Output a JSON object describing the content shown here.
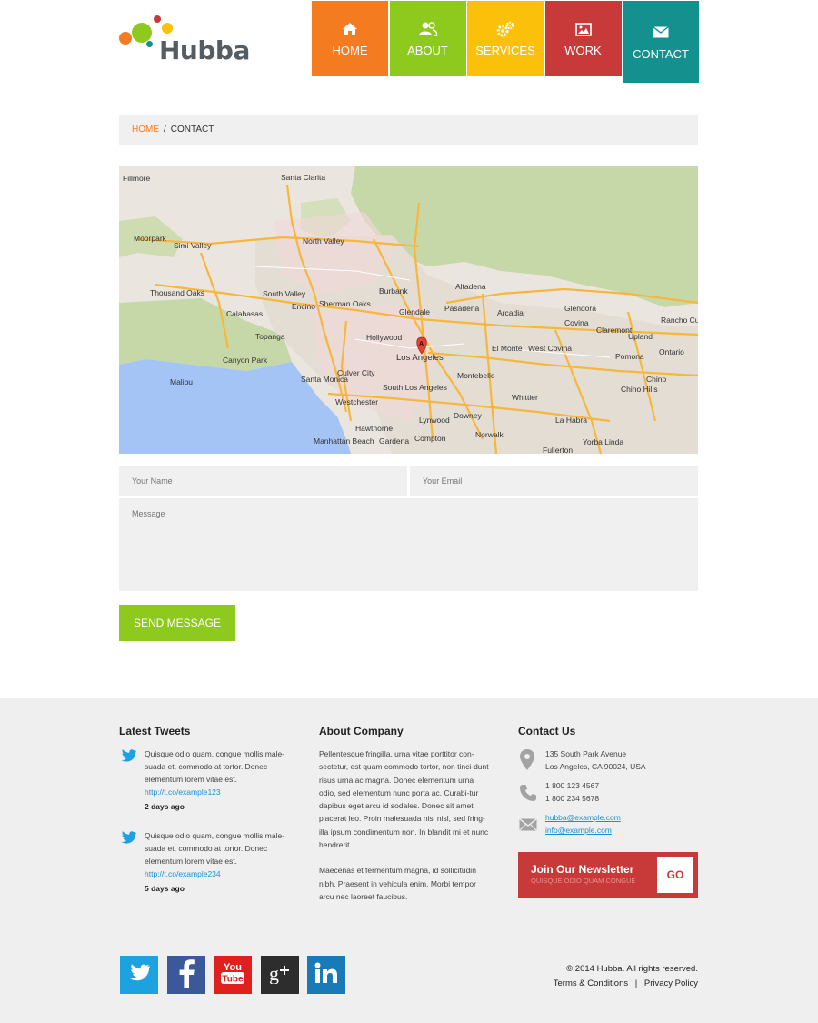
{
  "brand": {
    "name": "Hubba"
  },
  "nav": [
    {
      "label": "HOME",
      "color": "#f47b20",
      "icon": "home-icon"
    },
    {
      "label": "ABOUT",
      "color": "#8ec91e",
      "icon": "users-icon"
    },
    {
      "label": "SERVICES",
      "color": "#fbc10a",
      "icon": "gears-icon"
    },
    {
      "label": "WORK",
      "color": "#c73a39",
      "icon": "image-icon"
    },
    {
      "label": "CONTACT",
      "color": "#14908f",
      "icon": "envelope-icon",
      "active": true
    }
  ],
  "breadcrumb": {
    "home": "HOME",
    "separator": "/",
    "current": "CONTACT"
  },
  "map": {
    "labels": [
      "Santa Clarita",
      "Fillmore",
      "Moorpark",
      "Simi Valley",
      "North Valley",
      "Thousand Oaks",
      "South Valley",
      "Burbank",
      "Glendale",
      "Pasadena",
      "Arcadia",
      "Calabasas",
      "Hollywood",
      "Los Angeles",
      "El Monte",
      "West Covina",
      "Pomona",
      "Ontario",
      "Malibu",
      "Santa Monica",
      "Culver City",
      "South Los Angeles",
      "Montebello",
      "Downey",
      "Whittier",
      "Hawthorne",
      "Compton",
      "Norwalk",
      "La Habra",
      "Fullerton",
      "Yorba Linda",
      "Chino",
      "Chino Hills",
      "Westchester",
      "Manhattan Beach",
      "Gardena",
      "Lynwood",
      "Topanga",
      "Canyon Park",
      "Sherman Oaks",
      "Encino",
      "Altadena",
      "Covina",
      "Glendora",
      "Claremont",
      "Upland",
      "Rancho Cucamonga"
    ],
    "marker": "A"
  },
  "form": {
    "name_placeholder": "Your Name",
    "email_placeholder": "Your Email",
    "message_placeholder": "Message",
    "send_label": "SEND MESSAGE"
  },
  "footer": {
    "tweets_title": "Latest Tweets",
    "tweets": [
      {
        "text": "Quisque odio quam, congue mollis male-suada et, commodo at tortor. Donec elementum lorem vitae est.",
        "link": "http://t.co/example123",
        "ago": "2 days ago"
      },
      {
        "text": "Quisque odio quam, congue mollis male-suada et, commodo at tortor. Donec elementum lorem vitae est.",
        "link": "http://t.co/example234",
        "ago": "5 days ago"
      }
    ],
    "about_title": "About Company",
    "about_p1": "Pellentesque fringilla, urna vitae porttitor con-sectetur, est quam commodo tortor, non tinci-dunt risus urna ac magna. Donec elementum urna odio, sed elementum nunc porta ac. Curabi-tur dapibus eget arcu id sodales. Donec sit amet placerat leo.  Proin malesuada nisl nisl, sed fring-illa ipsum condimentum non. In blandit mi et nunc hendrerit.",
    "about_p2": "Maecenas et fermentum magna, id sollicitudin nibh. Praesent in vehicula enim. Morbi tempor arcu nec laoreet faucibus.",
    "contact_title": "Contact Us",
    "address_line1": "135 South Park Avenue",
    "address_line2": "Los Angeles, CA 90024, USA",
    "phone1": "1 800 123 4567",
    "phone2": "1 800 234 5678",
    "email1": "hubba@example.com",
    "email2": "info@example.com",
    "newsletter_title": "Join Our Newsletter",
    "newsletter_sub": "QUISQUE ODIO QUAM CONGUE",
    "newsletter_go": "GO",
    "social": [
      {
        "name": "twitter",
        "color": "#1da1e0"
      },
      {
        "name": "facebook",
        "color": "#3b5998"
      },
      {
        "name": "youtube",
        "color": "#e0201e"
      },
      {
        "name": "google-plus",
        "color": "#2d2d2d"
      },
      {
        "name": "linkedin",
        "color": "#1a7ab8"
      }
    ],
    "copyright": "© 2014 Hubba. All rights reserved.",
    "terms": "Terms & Conditions",
    "links_sep": "|",
    "privacy": "Privacy Policy"
  }
}
